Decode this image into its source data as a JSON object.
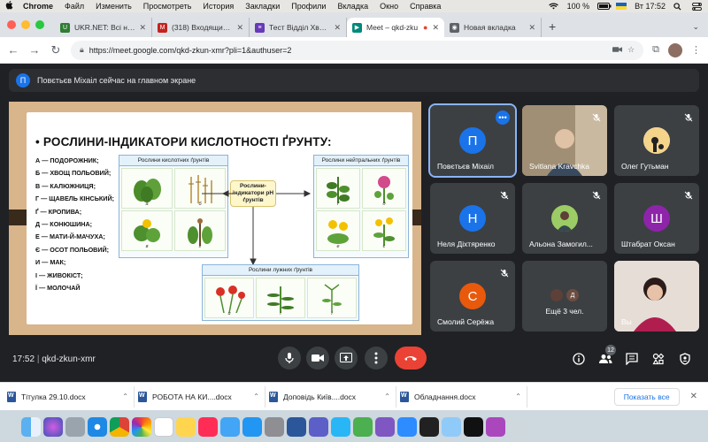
{
  "menubar": {
    "app": "Chrome",
    "items": [
      "Файл",
      "Изменить",
      "Просмотреть",
      "История",
      "Закладки",
      "Профили",
      "Вкладка",
      "Окно",
      "Справка"
    ],
    "battery": "100 %",
    "clock": "Вт 17:52"
  },
  "tabs": [
    {
      "title": "UKR.NET: Всі новини",
      "fav_color": "#2e7d32",
      "fav": "U"
    },
    {
      "title": "(318) Входящие - l",
      "fav_color": "#c5221f",
      "fav": "M"
    },
    {
      "title": "Тест Відділ Хвощен",
      "fav_color": "#673ab7",
      "fav": "≡"
    },
    {
      "title": "Meet – qkd-zku",
      "fav_color": "#00897b",
      "fav": "▶"
    },
    {
      "title": "Новая вкладка",
      "fav_color": "#5f6368",
      "fav": "◉"
    }
  ],
  "address": {
    "url": "https://meet.google.com/qkd-zkun-xmr?pli=1&authuser=2"
  },
  "banner": {
    "initial": "П",
    "text": "Повєтьєв Міхаіл сейчас на главном экране"
  },
  "slide": {
    "title": "• РОСЛИНИ-ІНДИКАТОРИ КИСЛОТНОСТІ ҐРУНТУ:",
    "list": [
      "А — ПОДОРОЖНИК;",
      "Б — ХВОЩ ПОЛЬОВИЙ;",
      "В — КАЛЮЖНИЦЯ;",
      "Г — ЩАВЕЛЬ КІНСЬКИЙ;",
      "Ґ — КРОПИВА;",
      "Д — КОНЮШИНА;",
      "Е — МАТИ-Й-МАЧУХА;",
      "Є — ОСОТ ПОЛЬОВИЙ;",
      "И — МАК;",
      "І — ЖИВОКІСТ;",
      "Ї — МОЛОЧАЙ"
    ],
    "acid_header": "Рослини кислотних ґрунтів",
    "neutral_header": "Рослини нейтральних ґрунтів",
    "alkaline_header": "Рослини лужних ґрунтів",
    "center_label": "Рослини-індикатори pH ґрунтів",
    "acid_letters": [
      "а",
      "б",
      "в",
      "г"
    ],
    "neutral_letters": [
      "ґ",
      "д",
      "е",
      "є"
    ],
    "alkaline_letters": [
      "и",
      "і",
      "ї"
    ]
  },
  "participants": [
    {
      "name": "Повєтьєв Міхаіл",
      "initial": "П",
      "color": "#e8710a"
    },
    {
      "name": "Svitlana Kravchka",
      "initial": "",
      "color": "#9e8b6e"
    },
    {
      "name": "Олег Гутьман",
      "initial": "",
      "color": "#f1f1f1"
    },
    {
      "name": "Неля Діхтяренко",
      "initial": "Н",
      "color": "#1a73e8"
    },
    {
      "name": "Альона Замогил...",
      "initial": "",
      "color": "#7cb342"
    },
    {
      "name": "Штабрат Оксан",
      "initial": "Ш",
      "color": "#8e24aa"
    },
    {
      "name": "Смолий Серёжа",
      "initial": "С",
      "color": "#e8590c"
    },
    {
      "name": "Ещё 3 чел.",
      "initial": "Д",
      "color": "#6d4c41"
    },
    {
      "name": "Вы",
      "initial": "",
      "color": "#c9b9b0"
    }
  ],
  "controls": {
    "time": "17:52",
    "meeting_code": "qkd-zkun-xmr",
    "people_count": "12"
  },
  "downloads": {
    "items": [
      "Тітулка 29.10.docx",
      "РОБОТА НА КИ....docx",
      "Доповідь Київ....docx",
      "Обладнання.docx"
    ],
    "show_all": "Показать все"
  },
  "dock": {
    "apps": [
      "finder",
      "siri",
      "launchpad",
      "safari",
      "chrome",
      "photos",
      "calendar",
      "notes",
      "music",
      "mail",
      "appstore",
      "settings",
      "word",
      "teams",
      "telegram",
      "utorrent",
      "viber",
      "zoom",
      "terminal",
      "preview",
      "tv",
      "podcasts",
      "trash"
    ]
  },
  "colors": {
    "meet_bg": "#202124",
    "tile_bg": "#3c4043",
    "end_call": "#ea4335",
    "accent": "#1a73e8"
  }
}
